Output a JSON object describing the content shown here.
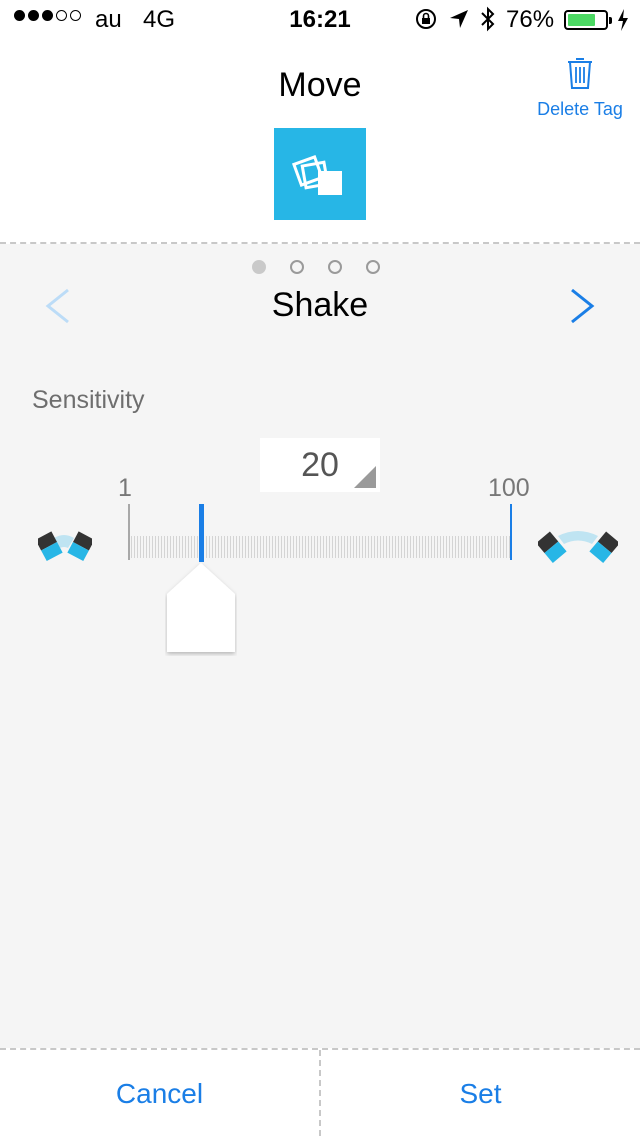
{
  "status_bar": {
    "signal_bars": 3,
    "signal_total": 5,
    "carrier": "au",
    "network": "4G",
    "time": "16:21",
    "battery_percent": "76%",
    "battery_level": 0.76,
    "battery_color": "#4cd964"
  },
  "header": {
    "title": "Move",
    "delete_label": "Delete Tag",
    "delete_icon": "trash-icon",
    "tag_icon": "move-tag-icon",
    "accent_color": "#27b6e6"
  },
  "mode_selector": {
    "current_mode": "Shake",
    "page_count": 4,
    "active_page": 1,
    "prev_icon": "chevron-left-icon",
    "next_icon": "chevron-right-icon"
  },
  "sensitivity": {
    "label": "Sensitivity",
    "value": "20",
    "min_label": "1",
    "max_label": "100",
    "min": 1,
    "max": 100,
    "current": 20,
    "low_icon": "low-sensitivity-icon",
    "high_icon": "high-sensitivity-icon",
    "link_color": "#1a7ee6"
  },
  "footer": {
    "cancel_label": "Cancel",
    "set_label": "Set"
  }
}
